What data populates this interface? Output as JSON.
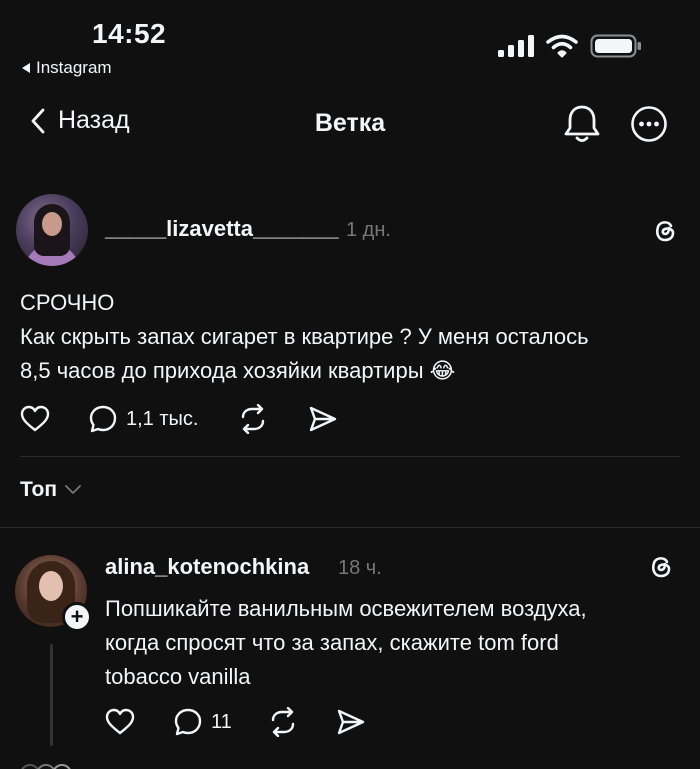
{
  "status_bar": {
    "time": "14:52",
    "back_app_label": "Instagram",
    "icons": [
      "cellular-signal-icon",
      "wifi-icon",
      "battery-icon"
    ]
  },
  "nav": {
    "back_label": "Назад",
    "title": "Ветка",
    "icons": [
      "chevron-left-icon",
      "bell-icon",
      "more-icon"
    ]
  },
  "post": {
    "username": "_____lizavetta_______",
    "timestamp": "1 дн.",
    "text_line1": "СРОЧНО",
    "text_line2": "Как скрыть запах сигарет в квартире ? У меня осталось",
    "text_line3": "8,5 часов до прихода хозяйки квартиры 😂",
    "reply_count": "1,1 тыс.",
    "icons": [
      "heart-icon",
      "comment-icon",
      "repost-icon",
      "share-icon",
      "threads-icon"
    ]
  },
  "sort": {
    "label": "Топ"
  },
  "reply": {
    "username": "alina_kotenochkina",
    "timestamp": "18 ч.",
    "text_line1": "Попшикайте ванильным освежителем воздуха,",
    "text_line2": "когда спросят что за запах, скажите tom ford",
    "text_line3": "tobacco vanilla",
    "reply_count": "11",
    "follow_badge": "+"
  },
  "colors": {
    "background": "#101010",
    "text": "#f3f5f7",
    "secondary_text": "#777777",
    "divider": "#2b2b2b"
  }
}
